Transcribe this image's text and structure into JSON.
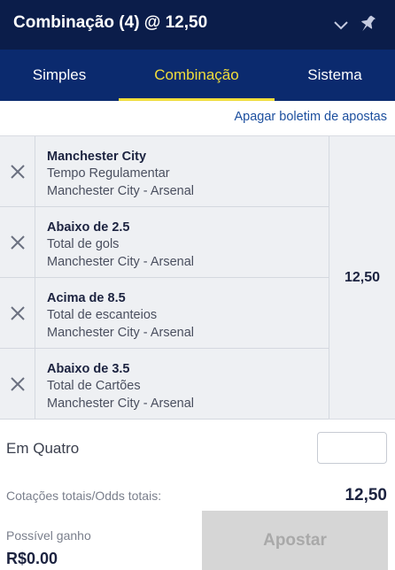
{
  "header": {
    "title": "Combinação (4) @ 12,50",
    "collapse_icon": "chevron-down-icon",
    "pin_icon": "pin-icon"
  },
  "tabs": [
    {
      "label": "Simples",
      "active": false
    },
    {
      "label": "Combinação",
      "active": true
    },
    {
      "label": "Sistema",
      "active": false
    }
  ],
  "clear_link": "Apagar boletim de apostas",
  "selections": [
    {
      "pick": "Manchester City",
      "market": "Tempo Regulamentar",
      "event": "Manchester City - Arsenal"
    },
    {
      "pick": "Abaixo de 2.5",
      "market": "Total de gols",
      "event": "Manchester City - Arsenal"
    },
    {
      "pick": "Acima de 8.5",
      "market": "Total de escanteios",
      "event": "Manchester City - Arsenal"
    },
    {
      "pick": "Abaixo de 3.5",
      "market": "Total de Cartões",
      "event": "Manchester City - Arsenal"
    }
  ],
  "combined_odds": "12,50",
  "stake": {
    "label": "Em Quatro",
    "value": "",
    "placeholder": ""
  },
  "totals": {
    "label": "Cotações totais/Odds totais:",
    "value": "12,50"
  },
  "potential_win": {
    "label": "Possível ganho",
    "value": "R$0.00"
  },
  "place_button": "Apostar",
  "colors": {
    "header_bg": "#0b1d4a",
    "tabs_bg": "#0b2a6e",
    "active_tab": "#f1de3b",
    "link": "#1b4e9e",
    "disabled_button": "#d6d6d6"
  }
}
